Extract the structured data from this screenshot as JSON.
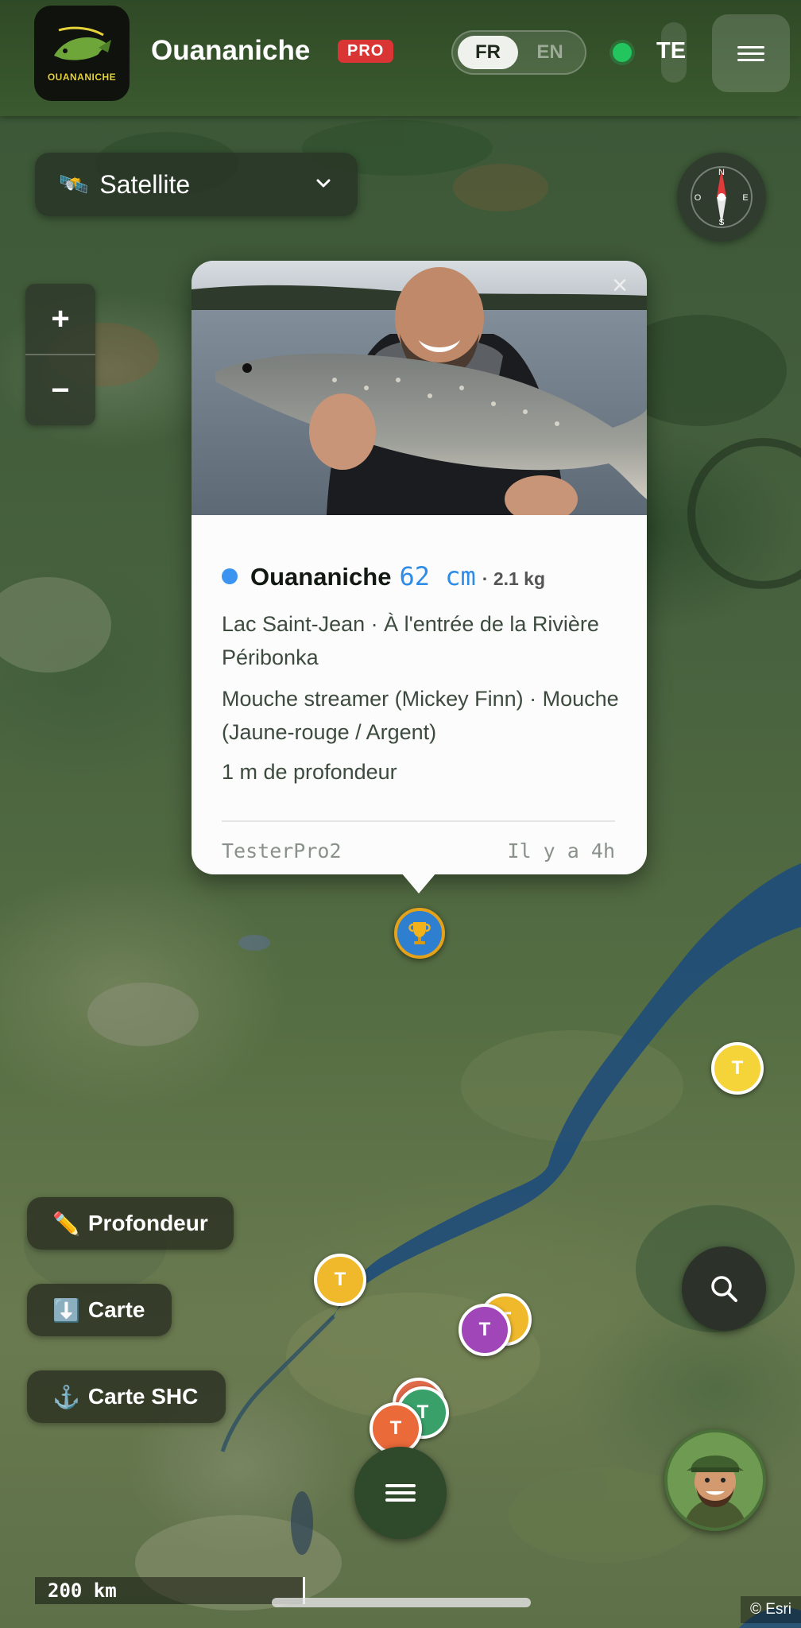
{
  "header": {
    "app_title": "Ouananiche",
    "logo_text": "OUANANICHE",
    "pro_badge": "PRO",
    "languages": [
      "FR",
      "EN"
    ],
    "active_language": "FR",
    "status_color": "#22c55e",
    "user_initials": "TE",
    "menu_icon": "hamburger-icon"
  },
  "map_controls": {
    "layer_icon": "satellite-icon",
    "layer_label": "Satellite",
    "zoom_in": "+",
    "zoom_out": "−",
    "compass_labels": [
      "N",
      "S",
      "E",
      "O"
    ]
  },
  "popup": {
    "close": "×",
    "species": "Ouananiche",
    "species_color": "#3b94f0",
    "length": "62 cm",
    "weight": "· 2.1 kg",
    "location": "Lac Saint-Jean · À l'entrée de la Rivière Péribonka",
    "lure": "Mouche streamer (Mickey Finn) · Mouche (Jaune-rouge / Argent)",
    "depth": "1 m de profondeur",
    "user": "TesterPro2",
    "time_ago": "Il y a 4h"
  },
  "markers": [
    {
      "label": "T",
      "color": "#f5d43a"
    },
    {
      "label": "T",
      "color": "#f0b92c"
    },
    {
      "label": "T",
      "color": "#f0b92c"
    },
    {
      "label": "T",
      "color": "#a046b8"
    },
    {
      "label": "T",
      "color": "#e06a4a"
    },
    {
      "label": "T",
      "color": "#3aa06a"
    },
    {
      "label": "T",
      "color": "#ea6a3a"
    }
  ],
  "trophy_marker": {
    "icon": "trophy-icon",
    "color": "#2f7fd0"
  },
  "side_buttons": {
    "depth": {
      "icon": "✏️",
      "label": "Profondeur"
    },
    "map": {
      "icon": "⬇️",
      "label": "Carte"
    },
    "shc": {
      "icon": "⚓",
      "label": "Carte SHC"
    }
  },
  "scale": "200 km",
  "attribution": "© Esri"
}
